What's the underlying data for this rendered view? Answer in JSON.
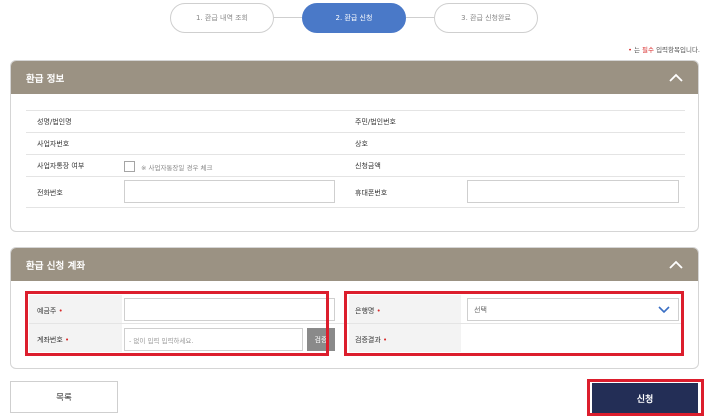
{
  "steps": [
    {
      "label": "1. 환급 내역 조회"
    },
    {
      "label": "2. 환급 신청"
    },
    {
      "label": "3. 환급 신청완료"
    }
  ],
  "required_note": {
    "star": "•",
    "prefix": "는 ",
    "emph": "필수",
    "suffix": " 입력항목입니다."
  },
  "refund_info": {
    "title": "환급 정보",
    "name_label": "성명/법인명",
    "resident_label": "주민/법인번호",
    "bizno_label": "사업자번호",
    "trade_label": "상호",
    "bizacct_label": "사업자통장 여부",
    "bizacct_hint": "※ 사업자통장일 경우 체크",
    "amount_label": "신청금액",
    "phone_label": "전화번호",
    "mobile_label": "휴대폰번호"
  },
  "account": {
    "title": "환급 신청 계좌",
    "holder_label": "예금주",
    "accno_label": "계좌번호",
    "accno_placeholder": "- 없이 입력 입력하세요.",
    "verify_label": "검증",
    "bank_label": "은행명",
    "bank_value": "선택",
    "result_label": "검증결과",
    "req_mark": "•"
  },
  "buttons": {
    "list": "목록",
    "submit": "신청"
  },
  "colors": {
    "panel_header": "#9b9283",
    "step_active": "#4a79c8",
    "submit": "#232e56",
    "highlight": "#dc1e2d"
  }
}
